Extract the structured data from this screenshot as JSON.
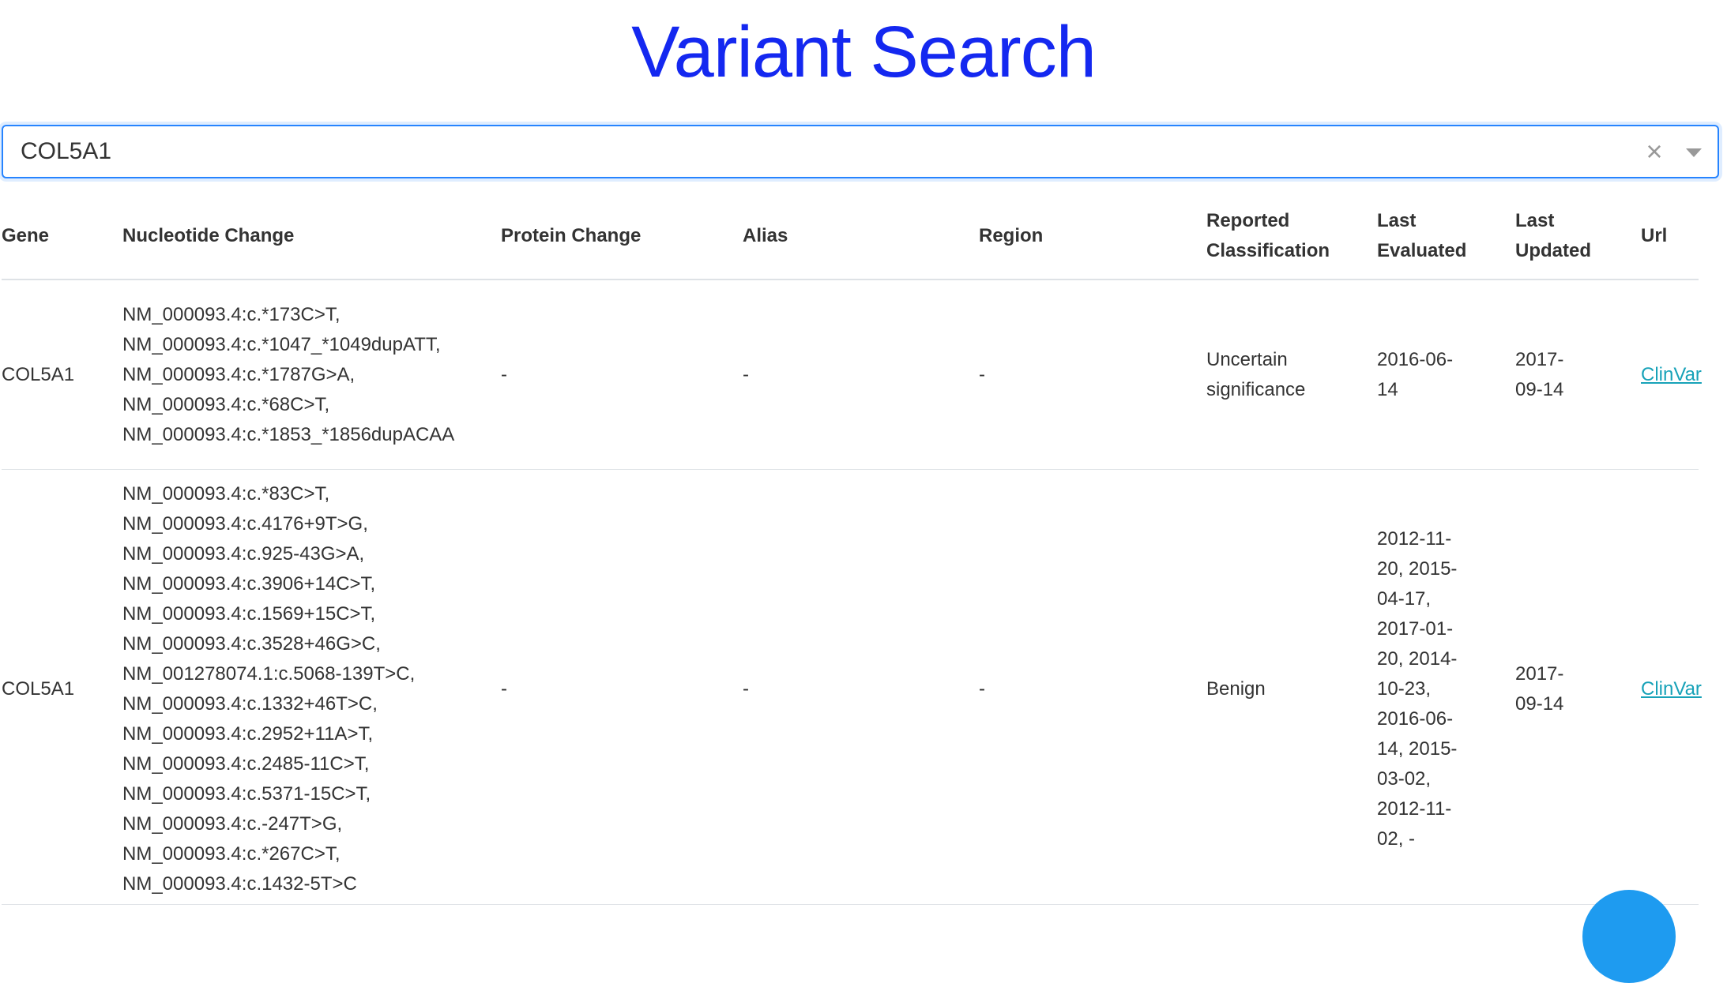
{
  "page": {
    "title": "Variant Search"
  },
  "search": {
    "value": "COL5A1"
  },
  "table": {
    "headers": {
      "gene": "Gene",
      "nucleotide_change": "Nucleotide Change",
      "protein_change": "Protein Change",
      "alias": "Alias",
      "region": "Region",
      "reported_classification": "Reported\nClassification",
      "last_evaluated": "Last\nEvaluated",
      "last_updated": "Last\nUpdated",
      "url": "Url"
    },
    "rows": [
      {
        "gene": "COL5A1",
        "nucleotide_change": "NM_000093.4:c.*173C>T,\nNM_000093.4:c.*1047_*1049dupATT,\nNM_000093.4:c.*1787G>A,\nNM_000093.4:c.*68C>T,\nNM_000093.4:c.*1853_*1856dupACAA",
        "protein_change": "-",
        "alias": "-",
        "region": "-",
        "reported_classification": "Uncertain\nsignificance",
        "last_evaluated": "2016-06-\n14",
        "last_updated": "2017-\n09-14",
        "url": "ClinVar"
      },
      {
        "gene": "COL5A1",
        "nucleotide_change": "NM_000093.4:c.*83C>T,\nNM_000093.4:c.4176+9T>G,\nNM_000093.4:c.925-43G>A,\nNM_000093.4:c.3906+14C>T,\nNM_000093.4:c.1569+15C>T,\nNM_000093.4:c.3528+46G>C,\nNM_001278074.1:c.5068-139T>C,\nNM_000093.4:c.1332+46T>C,\nNM_000093.4:c.2952+11A>T,\nNM_000093.4:c.2485-11C>T,\nNM_000093.4:c.5371-15C>T,\nNM_000093.4:c.-247T>G,\nNM_000093.4:c.*267C>T,\nNM_000093.4:c.1432-5T>C",
        "protein_change": "-",
        "alias": "-",
        "region": "-",
        "reported_classification": "Benign",
        "last_evaluated": "2012-11-\n20, 2015-\n04-17,\n2017-01-\n20, 2014-\n10-23,\n2016-06-\n14, 2015-\n03-02,\n2012-11-\n02, -",
        "last_updated": "2017-\n09-14",
        "url": "ClinVar"
      }
    ]
  },
  "colors": {
    "title": "#1428f0",
    "link": "#17a2b8",
    "focus_border": "#2684ff",
    "fab": "#1e9bf0"
  },
  "icons": {
    "clear": "close-icon",
    "dropdown": "chevron-down-icon"
  }
}
